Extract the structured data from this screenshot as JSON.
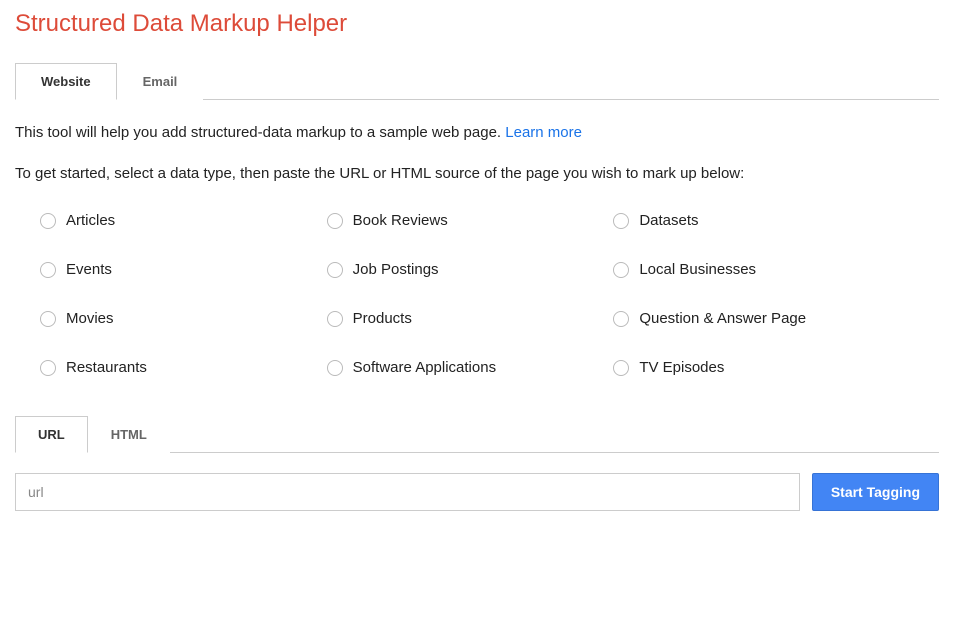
{
  "title": "Structured Data Markup Helper",
  "tabs": {
    "website": "Website",
    "email": "Email"
  },
  "intro": {
    "text": "This tool will help you add structured-data markup to a sample web page. ",
    "link": "Learn more"
  },
  "instructions": "To get started, select a data type, then paste the URL or HTML source of the page you wish to mark up below:",
  "data_types": [
    "Articles",
    "Book Reviews",
    "Datasets",
    "Events",
    "Job Postings",
    "Local Businesses",
    "Movies",
    "Products",
    "Question & Answer Page",
    "Restaurants",
    "Software Applications",
    "TV Episodes"
  ],
  "input_tabs": {
    "url": "URL",
    "html": "HTML"
  },
  "url_field": {
    "placeholder": "url"
  },
  "start_button": "Start Tagging"
}
